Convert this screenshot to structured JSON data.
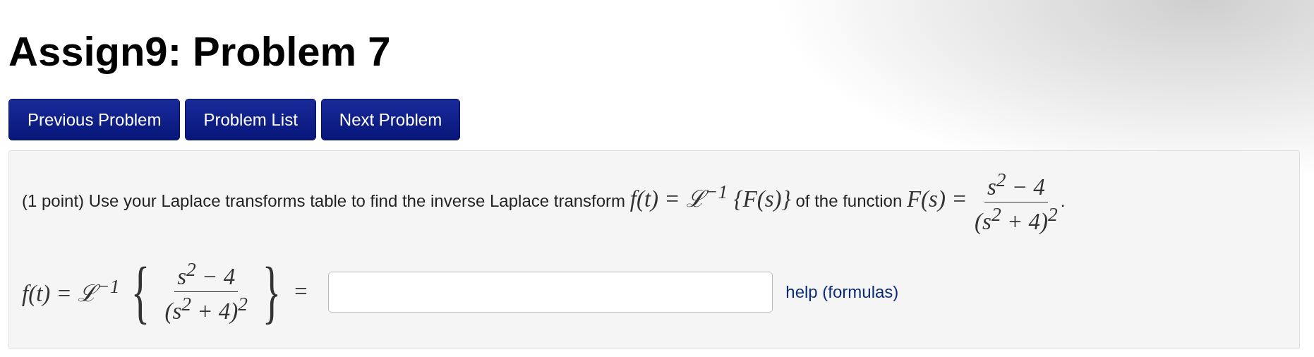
{
  "title": "Assign9: Problem 7",
  "nav_buttons": [
    "Previous Problem",
    "Problem List",
    "Next Problem"
  ],
  "problem": {
    "points": "(1 point)",
    "text_before": "Use your Laplace transforms table to find the inverse Laplace transform",
    "formula": "f(t) = ℒ$^{−1}$ {F(s)}",
    "text_middle": "of the function",
    "function_lhs": "F(s) =",
    "numerator": "s$^{2}$ − 4",
    "denominator": "(s$^{2}$ + 4)$^{2}$",
    "end": "."
  },
  "answer": {
    "lhs": "f(t) = ℒ$^{−1}$",
    "open_brace": "{",
    "numerator": "s$^{2}$ − 4",
    "denominator": "(s$^{2}$ + 4)$^{2}$",
    "close_brace": "}",
    "equals": "="
  },
  "help_link": "help (formulas)"
}
